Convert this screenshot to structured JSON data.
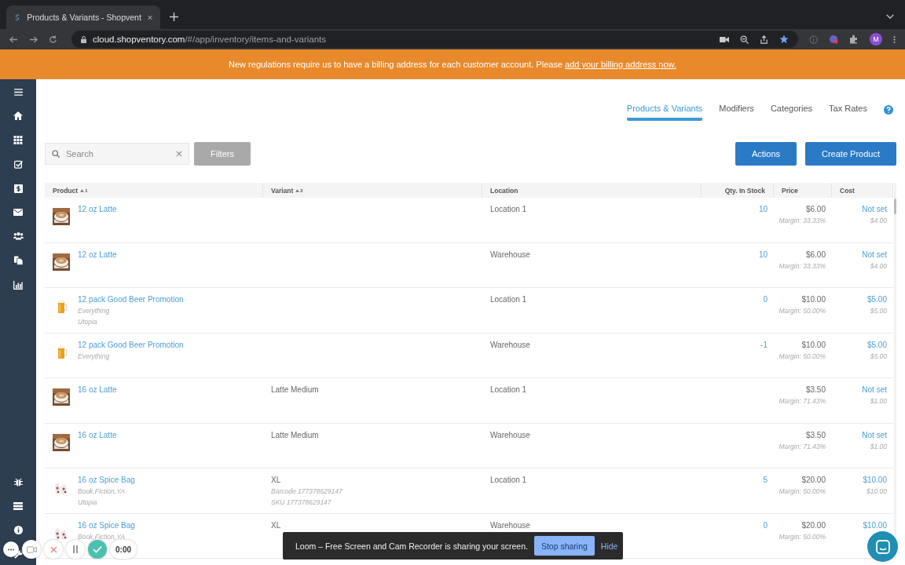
{
  "browser": {
    "tab_title": "Products & Variants - Shopvent",
    "url_domain": "cloud.shopventory.com",
    "url_path": "/#/app/inventory/items-and-variants",
    "profile_initial": "M"
  },
  "banner": {
    "text": "New regulations require us to have a billing address for each customer account. Please",
    "link": "add your billing address now."
  },
  "nav_tabs": [
    {
      "label": "Products & Variants",
      "selected": true
    },
    {
      "label": "Modifiers",
      "selected": false
    },
    {
      "label": "Categories",
      "selected": false
    },
    {
      "label": "Tax Rates",
      "selected": false
    }
  ],
  "search": {
    "placeholder": "Search"
  },
  "filters_button": {
    "label": "Filters",
    "disabled": true
  },
  "buttons": [
    "Actions",
    "Create Product"
  ],
  "table": {
    "columns": [
      {
        "label": "Product",
        "sort": "1"
      },
      {
        "label": "Variant",
        "sort": "2"
      },
      {
        "label": "Location"
      },
      {
        "label": "Qty. In Stock"
      },
      {
        "label": "Price"
      },
      {
        "label": "Cost"
      }
    ],
    "rows": [
      {
        "kind": "latte",
        "product": "12 oz Latte",
        "product_lines": [],
        "variant": "",
        "variant_lines": [],
        "location": "Location 1",
        "qty": "10",
        "price": "$6.00",
        "margin": "Margin: 33.33%",
        "cost": "Not set",
        "cost_sub": "$4.00"
      },
      {
        "kind": "latte",
        "product": "12 oz Latte",
        "product_lines": [],
        "variant": "",
        "variant_lines": [],
        "location": "Warehouse",
        "qty": "10",
        "price": "$6.00",
        "margin": "Margin: 33.33%",
        "cost": "Not set",
        "cost_sub": "$4.00"
      },
      {
        "kind": "beer",
        "product": "12 pack Good Beer Promotion",
        "product_lines": [
          "Everything",
          "Utopia"
        ],
        "variant": "",
        "variant_lines": [],
        "location": "Location 1",
        "qty": "0",
        "price": "$10.00",
        "margin": "Margin: 50.00%",
        "cost": "$5.00",
        "cost_sub": "$5.00"
      },
      {
        "kind": "beer",
        "product": "12 pack Good Beer Promotion",
        "product_lines": [
          "Everything"
        ],
        "variant": "",
        "variant_lines": [],
        "location": "Warehouse",
        "qty": "-1",
        "price": "$10.00",
        "margin": "Margin: 50.00%",
        "cost": "$5.00",
        "cost_sub": "$5.00"
      },
      {
        "kind": "latte",
        "product": "16 oz Latte",
        "product_lines": [],
        "variant": "Latte Medium",
        "variant_lines": [],
        "location": "Location 1",
        "qty": "",
        "price": "$3.50",
        "margin": "Margin: 71.43%",
        "cost": "Not set",
        "cost_sub": "$1.00"
      },
      {
        "kind": "latte",
        "product": "16 oz Latte",
        "product_lines": [],
        "variant": "Latte Medium",
        "variant_lines": [],
        "location": "Warehouse",
        "qty": "",
        "price": "$3.50",
        "margin": "Margin: 71.43%",
        "cost": "Not set",
        "cost_sub": "$1.00"
      },
      {
        "kind": "spice",
        "product": "16 oz Spice Bag",
        "product_lines": [
          "Book,Fiction,YA",
          "Utopia"
        ],
        "variant": "XL",
        "variant_lines": [
          "Barcode 177378629147",
          "SKU 177378629147"
        ],
        "location": "Location 1",
        "qty": "5",
        "price": "$20.00",
        "margin": "Margin: 50.00%",
        "cost": "$10.00",
        "cost_sub": "$10.00"
      },
      {
        "kind": "spice",
        "product": "16 oz Spice Bag",
        "product_lines": [
          "Book,Fiction,YA"
        ],
        "variant": "XL",
        "variant_lines": [],
        "location": "Warehouse",
        "qty": "0",
        "price": "$20.00",
        "margin": "Margin: 50.00%",
        "cost": "$10.00",
        "cost_sub": ""
      }
    ]
  },
  "loom_bar": {
    "message": "Loom – Free Screen and Cam Recorder is sharing your screen.",
    "stop": "Stop sharing",
    "hide": "Hide"
  },
  "loom_controls": {
    "timer": "0:00"
  }
}
